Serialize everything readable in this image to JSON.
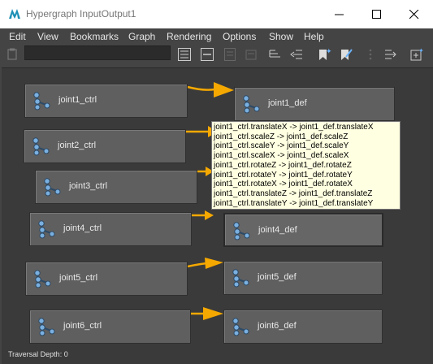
{
  "window": {
    "title": "Hypergraph InputOutput1"
  },
  "menu": [
    "Edit",
    "View",
    "Bookmarks",
    "Graph",
    "Rendering",
    "Options",
    "Show",
    "Help"
  ],
  "toolbar": {
    "icons": [
      "clipboard-icon",
      "frame-all-icon",
      "frame-selection-icon",
      "frame-hierarchy-icon",
      "frame-branch-icon",
      "input-connections-icon",
      "output-connections-icon",
      "create-bookmark-icon",
      "edit-bookmark-icon",
      "toggle-panel-icon",
      "scene-hierarchy-icon",
      "add-node-icon"
    ]
  },
  "nodes": [
    {
      "label": "joint1_ctrl"
    },
    {
      "label": "joint2_ctrl"
    },
    {
      "label": "joint3_ctrl"
    },
    {
      "label": "joint4_ctrl"
    },
    {
      "label": "joint5_ctrl"
    },
    {
      "label": "joint6_ctrl"
    },
    {
      "label": "joint1_def"
    },
    {
      "label": "joint4_def"
    },
    {
      "label": "joint5_def"
    },
    {
      "label": "joint6_def"
    }
  ],
  "tooltip": {
    "lines": [
      "joint1_ctrl.translateX -> joint1_def.translateX",
      "joint1_ctrl.scaleZ -> joint1_def.scaleZ",
      "joint1_ctrl.scaleY -> joint1_def.scaleY",
      "joint1_ctrl.scaleX -> joint1_def.scaleX",
      "joint1_ctrl.rotateZ -> joint1_def.rotateZ",
      "joint1_ctrl.rotateY -> joint1_def.rotateY",
      "joint1_ctrl.rotateX -> joint1_def.rotateX",
      "joint1_ctrl.translateZ -> joint1_def.translateZ",
      "joint1_ctrl.translateY -> joint1_def.translateY"
    ]
  },
  "status": {
    "text": "Traversal Depth: 0"
  },
  "colors": {
    "connection": "#f5a800",
    "node_icon": "#7ab0e0",
    "tooltip_bg": "#ffffe1"
  }
}
